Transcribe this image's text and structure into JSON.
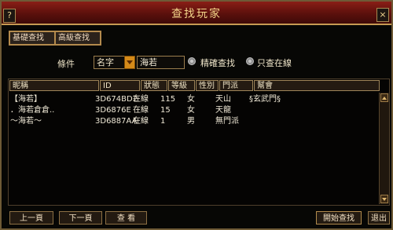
{
  "window": {
    "title": "查找玩家",
    "help_label": "?",
    "close_label": "×"
  },
  "tabs": [
    {
      "label": "基礎查找"
    },
    {
      "label": "高級查找"
    }
  ],
  "search": {
    "condition_label": "條件",
    "field_value": "名字",
    "query_value": "海若",
    "precise_label": "精確查找",
    "online_only_label": "只查在線"
  },
  "table": {
    "headers": [
      "昵稱",
      "ID",
      "狀態",
      "等級",
      "性別",
      "門派",
      "幫會"
    ],
    "rows": [
      {
        "nick": "【海若】",
        "id": "3D674BD2",
        "status": "在線",
        "level": "115",
        "gender": "女",
        "sect": "天山",
        "guild": "§玄武門§"
      },
      {
        "nick": "．海若倉倉..",
        "id": "3D6876E",
        "status": "在線",
        "level": "15",
        "gender": "女",
        "sect": "天龍",
        "guild": ""
      },
      {
        "nick": "～海若～",
        "id": "3D6887AA",
        "status": "在線",
        "level": "1",
        "gender": "男",
        "sect": "無門派",
        "guild": ""
      }
    ]
  },
  "footer": {
    "prev_label": "上一頁",
    "next_label": "下一頁",
    "view_label": "查 看",
    "start_label": "開始查找",
    "exit_label": "退出"
  }
}
